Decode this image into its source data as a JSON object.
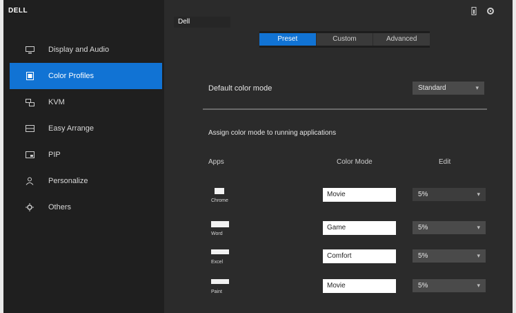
{
  "app": {
    "logo": "DELL"
  },
  "sidebar": {
    "items": [
      {
        "label": "Display and Audio",
        "icon": "display-icon",
        "active": false
      },
      {
        "label": "Color Profiles",
        "icon": "palette-icon",
        "active": true
      },
      {
        "label": "KVM",
        "icon": "kvm-icon",
        "active": false
      },
      {
        "label": "Easy Arrange",
        "icon": "layout-icon",
        "active": false
      },
      {
        "label": "PIP",
        "icon": "pip-icon",
        "active": false
      },
      {
        "label": "Personalize",
        "icon": "person-icon",
        "active": false
      },
      {
        "label": "Others",
        "icon": "gear-icon",
        "active": false
      }
    ]
  },
  "header": {
    "monitor": "Dell",
    "icons": [
      "info-icon",
      "settings-icon"
    ]
  },
  "tabs": [
    {
      "label": "Preset",
      "active": true
    },
    {
      "label": "Custom",
      "active": false
    },
    {
      "label": "Advanced",
      "active": false
    }
  ],
  "default_mode": {
    "label": "Default color mode",
    "value": "Standard"
  },
  "app_section": {
    "title": "Assign color mode to running applications",
    "columns": [
      "Apps",
      "Color Mode",
      "Edit"
    ]
  },
  "app_rows": [
    {
      "name": "Chrome",
      "mode": "Movie",
      "edit": "5%"
    },
    {
      "name": "Word",
      "mode": "Game",
      "edit": "5%"
    },
    {
      "name": "Excel",
      "mode": "Comfort",
      "edit": "5%"
    },
    {
      "name": "Paint",
      "mode": "Movie",
      "edit": "5%"
    }
  ],
  "colors": {
    "accent": "#1173d4",
    "sidebar": "#1f1f1f",
    "panel": "#2b2b2b"
  }
}
